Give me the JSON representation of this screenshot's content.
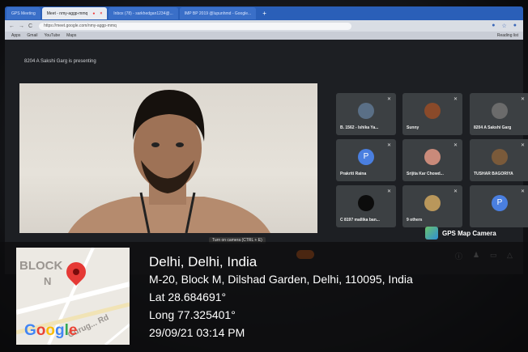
{
  "browser": {
    "tabs": [
      {
        "label": "GPS Meeting",
        "active": false
      },
      {
        "label": "Meet - nmy-aggp-mmq",
        "active": true
      },
      {
        "label": "Inbox (78) - sarkhedgan1234@...",
        "active": false
      },
      {
        "label": "IMP BP 2019 @lupunhmd - Google...",
        "active": false
      }
    ],
    "url": "https://meet.google.com/nmy-aggp-mmq",
    "bookmarks": [
      "Apps",
      "Gmail",
      "YouTube",
      "Maps"
    ],
    "reading_list": "Reading list"
  },
  "meet": {
    "presenting": "8204 A Sakshi Garg is presenting",
    "camera_note": "Turn on camera (CTRL + E)",
    "participants": [
      {
        "name": "B. 1562 - Ishika Ya...",
        "avatar": "photo"
      },
      {
        "name": "Sunny",
        "avatar": "photo"
      },
      {
        "name": "8204 A Sakshi Garg",
        "avatar": "photo"
      },
      {
        "name": "Prakriti Raina",
        "avatar": "letter",
        "letter": "P",
        "color": "#4a7fe0"
      },
      {
        "name": "Srijita Kar Chowd...",
        "avatar": "photo"
      },
      {
        "name": "TUSHAR BAGORIYA",
        "avatar": "photo"
      },
      {
        "name": "C 8197 mallika ban...",
        "avatar": "photo"
      },
      {
        "name": "9 others",
        "avatar": "group"
      },
      {
        "name": "",
        "avatar": "letter",
        "letter": "P",
        "color": "#4a7fe0"
      }
    ]
  },
  "gps": {
    "badge": "GPS Map Camera",
    "map_labels": {
      "block": "BLOCK",
      "n": "N",
      "road": "Gurug... Rd",
      "logo": "Google"
    },
    "city": "Delhi, Delhi, India",
    "address": "M-20, Block M, Dilshad Garden, Delhi, 110095, India",
    "lat": "Lat 28.684691°",
    "long": "Long 77.325401°",
    "datetime": "29/09/21 03:14 PM"
  }
}
